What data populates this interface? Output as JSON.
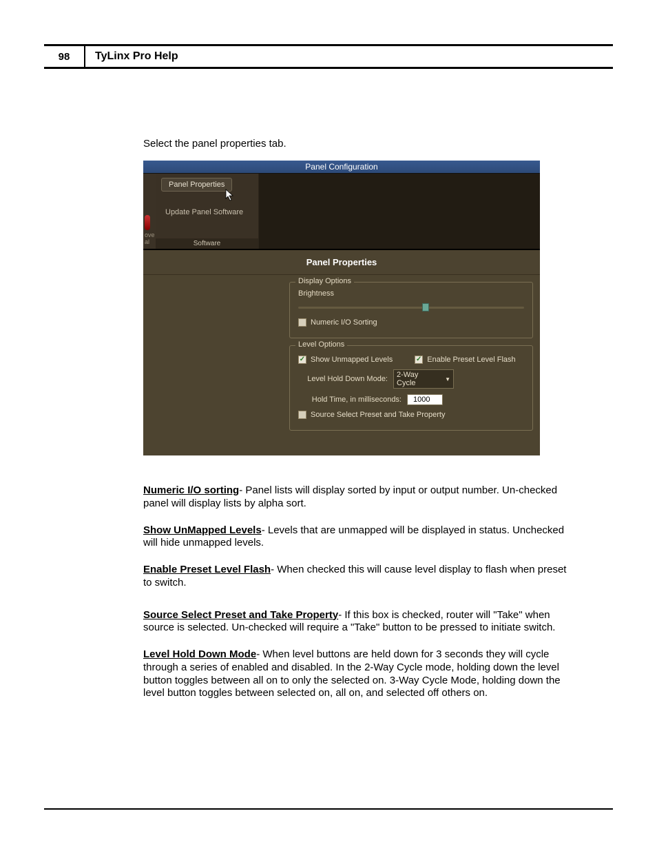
{
  "header": {
    "page_number": "98",
    "doc_title": "TyLinx Pro Help"
  },
  "intro": "Select the panel properties tab.",
  "ribbon": {
    "title": "Panel Configuration",
    "tab_label": "Panel Properties",
    "button_label": "Update Panel Software",
    "group_label": "Software",
    "left_strip_a": "ove",
    "left_strip_b": "al"
  },
  "properties": {
    "panel_title": "Panel Properties",
    "display": {
      "legend": "Display Options",
      "brightness_label": "Brightness",
      "numeric_sort_label": "Numeric I/O Sorting",
      "numeric_sort_checked": false
    },
    "level": {
      "legend": "Level Options",
      "show_unmapped_label": "Show Unmapped Levels",
      "show_unmapped_checked": true,
      "enable_flash_label": "Enable Preset Level Flash",
      "enable_flash_checked": true,
      "hold_mode_label": "Level Hold Down Mode:",
      "hold_mode_value": "2-Way Cycle",
      "hold_time_label": "Hold Time, in milliseconds:",
      "hold_time_value": "1000",
      "source_select_label": "Source Select Preset and Take Property",
      "source_select_checked": false
    }
  },
  "paragraphs": {
    "p1_term": "Numeric I/O sorting",
    "p1_body": "- Panel lists will display sorted by input or output number. Un-checked panel will display lists by alpha sort.",
    "p2_term": "Show UnMapped Levels",
    "p2_body": "- Levels that are unmapped will be displayed in status. Unchecked will hide unmapped levels.",
    "p3_term": "Enable Preset Level Flash",
    "p3_body": "- When checked this will cause level display to flash when preset to switch.",
    "p4_term": "Source Select Preset and Take Property",
    "p4_body": "- If this box is checked, router will \"Take\" when source is selected. Un-checked will require a \"Take\" button to be pressed to initiate switch.",
    "p5_term": "Level Hold Down Mode",
    "p5_body": "- When level buttons are held down for 3 seconds they will cycle through a series of enabled and disabled. In the 2-Way Cycle mode, holding down the level button toggles between all on to only the selected on. 3-Way Cycle Mode, holding down the level button toggles between selected on, all on, and selected off others on."
  }
}
